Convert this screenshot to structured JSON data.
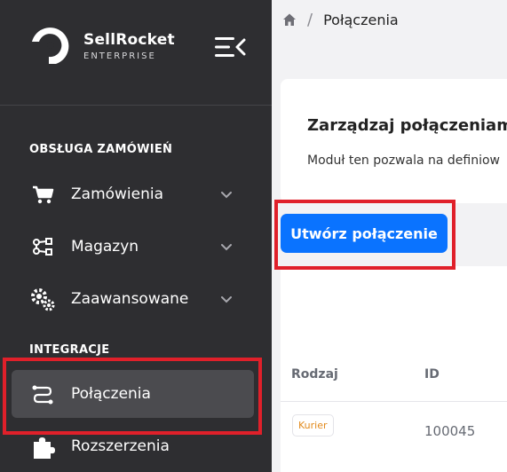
{
  "brand": {
    "name": "SellRocket",
    "subtitle": "ENTERPRISE"
  },
  "sidebar": {
    "sections": [
      {
        "label": "OBSŁUGA ZAMÓWIEŃ"
      },
      {
        "label": "INTEGRACJE"
      }
    ],
    "items": [
      {
        "label": "Zamówienia",
        "icon": "cart-icon",
        "expandable": true
      },
      {
        "label": "Magazyn",
        "icon": "warehouse-icon",
        "expandable": true
      },
      {
        "label": "Zaawansowane",
        "icon": "gears-icon",
        "expandable": true
      },
      {
        "label": "Połączenia",
        "icon": "connections-icon",
        "active": true
      },
      {
        "label": "Rozszerzenia",
        "icon": "puzzle-icon"
      }
    ]
  },
  "breadcrumb": {
    "home_icon": "home-icon",
    "separator": "/",
    "current": "Połączenia"
  },
  "card": {
    "title": "Zarządzaj połączeniam",
    "description": "Moduł ten pozwala na definiow"
  },
  "actions": {
    "create_label": "Utwórz połączenie"
  },
  "table": {
    "headers": [
      "Rodzaj",
      "ID"
    ],
    "rows": [
      {
        "type": "Kurier",
        "id": "100045"
      }
    ]
  },
  "colors": {
    "sidebar_bg": "#2e2e31",
    "active_item_bg": "#4b4b4f",
    "primary": "#0a73ff",
    "highlight": "#e0202a",
    "badge_text": "#e28a1c"
  }
}
